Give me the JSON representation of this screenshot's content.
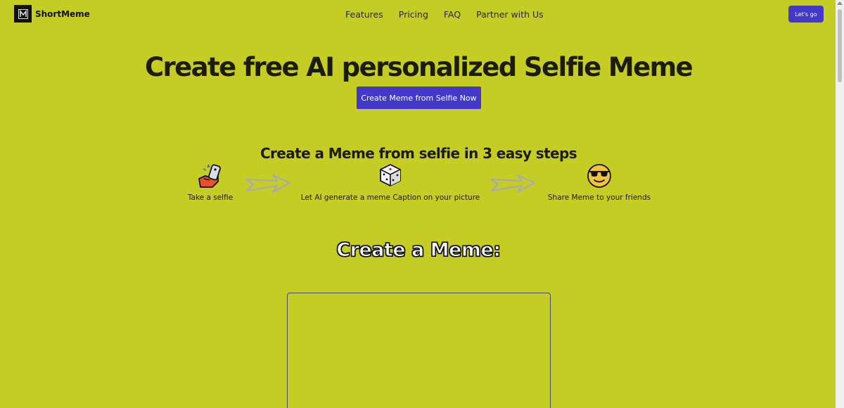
{
  "brand": {
    "name": "ShortMeme",
    "logo_letter": "M"
  },
  "nav": {
    "items": [
      "Features",
      "Pricing",
      "FAQ",
      "Partner with Us"
    ],
    "cta_label": "Let's go"
  },
  "hero": {
    "title": "Create free AI personalized Selfie Meme",
    "cta_label": "Create Meme from Selfie Now"
  },
  "steps": {
    "title": "Create a Meme from selfie in 3 easy steps",
    "items": [
      {
        "label": "Take a selfie",
        "icon": "selfie-hand-icon"
      },
      {
        "label": "Let AI generate a meme Caption on your picture",
        "icon": "dice-icon"
      },
      {
        "label": "Share Meme to your friends",
        "icon": "sunglasses-face-icon"
      }
    ]
  },
  "create": {
    "heading": "Create a Meme:"
  },
  "colors": {
    "background": "#c5cc24",
    "accent": "#4338ca"
  }
}
